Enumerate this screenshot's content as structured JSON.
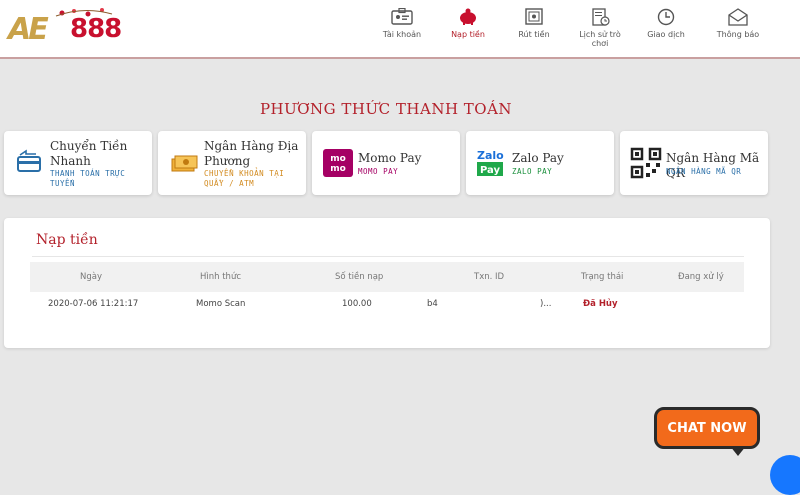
{
  "logo": {
    "part1": "AE",
    "part2": "888"
  },
  "nav": [
    {
      "label": "Tài khoản",
      "icon": "id-card-icon"
    },
    {
      "label": "Nạp tiền",
      "icon": "piggy-bank-icon",
      "active": true
    },
    {
      "label": "Rút tiền",
      "icon": "safe-icon"
    },
    {
      "label": "Lịch sử trò chơi",
      "icon": "history-doc-icon"
    },
    {
      "label": "Giao dịch",
      "icon": "clock-icon"
    },
    {
      "label": "Thông báo",
      "icon": "mail-icon"
    }
  ],
  "section_title": "PHƯƠNG THỨC THANH TOÁN",
  "payment_methods": [
    {
      "name": "Chuyển Tiền Nhanh",
      "sub": "THANH TOÁN TRỰC TUYẾN",
      "icon": "card-transfer-icon",
      "sub_color": "#2a6fa8"
    },
    {
      "name": "Ngân Hàng Địa Phương",
      "sub": "CHUYỂN KHOẢN TẠI QUẦY / ATM",
      "icon": "cash-icon",
      "sub_color": "#d28a1e"
    },
    {
      "name": "Momo Pay",
      "sub": "MOMO PAY",
      "icon": "momo-logo-icon",
      "sub_color": "#a50064"
    },
    {
      "name": "Zalo Pay",
      "sub": "ZALO PAY",
      "icon": "zalopay-logo-icon",
      "sub_color": "#1a8f3c"
    },
    {
      "name": "Ngân Hàng Mã QR",
      "sub": "NGÂN HÀNG MÃ QR",
      "icon": "qr-code-icon",
      "sub_color": "#2a6fa8"
    }
  ],
  "deposit": {
    "title": "Nạp tiền",
    "headers": [
      "Ngày",
      "Hình thức",
      "Số tiền nạp",
      "Txn. ID",
      "Trạng thái",
      "Đang xử lý"
    ],
    "rows": [
      {
        "date": "2020-07-06 11:21:17",
        "method": "Momo Scan",
        "amount": "100.00",
        "txn_a": "b4",
        "txn_b": ")...",
        "status": "Đã Hủy",
        "processing": ""
      }
    ]
  },
  "chat": {
    "label": "CHAT NOW"
  },
  "colors": {
    "accent": "#b3212b",
    "chat": "#f26a1b",
    "background": "#e7e7e7"
  }
}
